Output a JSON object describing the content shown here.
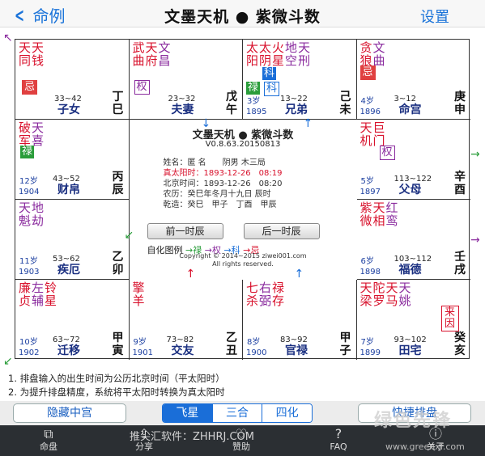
{
  "nav": {
    "back": "命例",
    "title": "文墨天机 ● 紫微斗数",
    "settings": "设置"
  },
  "colors": {
    "accent": "#1a73d9",
    "red": "#d8102b",
    "green": "#2a9d3a",
    "purple": "#8a2b9e"
  },
  "cells": [
    {
      "cols": [
        [
          "天",
          "同"
        ],
        [
          "天",
          "钱"
        ]
      ],
      "colors": [
        "#d8102b",
        "#d8102b"
      ],
      "hua": [
        {
          "t": "忌",
          "cls": "h-ji",
          "l": 8,
          "t2": 50
        }
      ],
      "age": "",
      "year": "",
      "range": "33~42",
      "palace": "子女",
      "gz": [
        "丁",
        "巳"
      ]
    },
    {
      "cols": [
        [
          "武",
          "曲"
        ],
        [
          "天",
          "府"
        ],
        [
          "文",
          "昌"
        ]
      ],
      "colors": [
        "#d8102b",
        "#d8102b",
        "#8a2b9e"
      ],
      "hua": [
        {
          "t": "权",
          "cls": "h-quan",
          "l": 6,
          "t2": 50
        }
      ],
      "age": "",
      "year": "",
      "range": "23~32",
      "palace": "夫妻",
      "gz": [
        "戊",
        "午"
      ]
    },
    {
      "cols": [
        [
          "太",
          "阳"
        ],
        [
          "太",
          "阴"
        ],
        [
          "火",
          "星"
        ],
        [
          "地",
          "空"
        ],
        [
          "天",
          "刑"
        ]
      ],
      "colors": [
        "#d8102b",
        "#d8102b",
        "#d8102b",
        "#8a2b9e",
        "#8a2b9e"
      ],
      "hua": [
        {
          "t": "科",
          "cls": "h-kered",
          "l": 24,
          "t2": 34
        },
        {
          "t": "禄",
          "cls": "h-lu",
          "l": 4,
          "t2": 52
        },
        {
          "t": "科",
          "cls": "h-ke",
          "l": 26,
          "t2": 52
        }
      ],
      "age": "3岁",
      "year": "1895",
      "range": "13~22",
      "palace": "兄弟",
      "gz": [
        "己",
        "未"
      ]
    },
    {
      "cols": [
        [
          "贪",
          "狼"
        ],
        [
          "文",
          "曲"
        ]
      ],
      "colors": [
        "#d8102b",
        "#8a2b9e"
      ],
      "hua": [
        {
          "t": "忌",
          "cls": "h-ji",
          "l": 4,
          "t2": 32
        }
      ],
      "age": "4岁",
      "year": "1896",
      "range": "3~12",
      "palace": "命宫",
      "gz": [
        "庚",
        "申"
      ]
    },
    {
      "cols": [
        [
          "破",
          "军"
        ],
        [
          "天",
          "喜"
        ]
      ],
      "colors": [
        "#d8102b",
        "#8a2b9e"
      ],
      "hua": [
        {
          "t": "禄",
          "cls": "h-lu",
          "l": 6,
          "t2": 32
        }
      ],
      "age": "12岁",
      "year": "1904",
      "range": "43~52",
      "palace": "财帛",
      "gz": [
        "丙",
        "辰"
      ]
    },
    {
      "cols": [
        [
          "天",
          "机"
        ],
        [
          "巨",
          "门"
        ]
      ],
      "colors": [
        "#d8102b",
        "#d8102b"
      ],
      "hua": [
        {
          "t": "权",
          "cls": "h-quan",
          "l": 28,
          "t2": 32
        }
      ],
      "age": "5岁",
      "year": "1897",
      "range": "113~122",
      "palace": "父母",
      "gz": [
        "辛",
        "酉"
      ]
    },
    {
      "cols": [
        [
          "天",
          "魁"
        ],
        [
          "地",
          "劫"
        ]
      ],
      "colors": [
        "#8a2b9e",
        "#8a2b9e"
      ],
      "hua": [],
      "age": "11岁",
      "year": "1903",
      "range": "53~62",
      "palace": "疾厄",
      "gz": [
        "乙",
        "卯"
      ]
    },
    {
      "cols": [
        [
          "紫",
          "微"
        ],
        [
          "天",
          "相"
        ],
        [
          "红",
          "鸾"
        ]
      ],
      "colors": [
        "#d8102b",
        "#d8102b",
        "#8a2b9e"
      ],
      "hua": [],
      "age": "6岁",
      "year": "1898",
      "range": "103~112",
      "palace": "福德",
      "gz": [
        "壬",
        "戌"
      ]
    },
    {
      "cols": [
        [
          "廉",
          "贞"
        ],
        [
          "左",
          "辅"
        ],
        [
          "铃",
          "星"
        ]
      ],
      "colors": [
        "#d8102b",
        "#8a2b9e",
        "#d8102b"
      ],
      "hua": [],
      "age": "10岁",
      "year": "1902",
      "range": "63~72",
      "palace": "迁移",
      "gz": [
        "甲",
        "寅"
      ]
    },
    {
      "cols": [
        [
          "擎",
          "羊"
        ]
      ],
      "colors": [
        "#d8102b"
      ],
      "hua": [],
      "age": "9岁",
      "year": "1901",
      "range": "73~82",
      "palace": "交友",
      "gz": [
        "乙",
        "丑"
      ]
    },
    {
      "cols": [
        [
          "七",
          "杀"
        ],
        [
          "右",
          "弼"
        ],
        [
          "禄",
          "存"
        ]
      ],
      "colors": [
        "#d8102b",
        "#8a2b9e",
        "#d8102b"
      ],
      "hua": [],
      "age": "8岁",
      "year": "1900",
      "range": "83~92",
      "palace": "官禄",
      "gz": [
        "甲",
        "子"
      ]
    },
    {
      "cols": [
        [
          "天",
          "梁"
        ],
        [
          "陀",
          "罗"
        ],
        [
          "天",
          "马"
        ],
        [
          "天",
          "姚"
        ]
      ],
      "colors": [
        "#d8102b",
        "#d8102b",
        "#d8102b",
        "#8a2b9e"
      ],
      "hua": [
        {
          "t": "来因",
          "cls": "h-quanred",
          "l": 104,
          "t2": 32
        }
      ],
      "age": "7岁",
      "year": "1899",
      "range": "93~102",
      "palace": "田宅",
      "gz": [
        "癸",
        "亥"
      ]
    }
  ],
  "center": {
    "title": "文墨天机 ● 紫微斗数",
    "version": "V0.8.63.20150813",
    "name": "姓名：匿 名　　阴男 木三局",
    "true_time": "真太阳时：1893-12-26　08:19",
    "beijing": "北京时间：1893-12-26　08:20",
    "lunar": "农历：癸巳年冬月十九日 辰时",
    "bazi": "乾造：癸巳　甲子　丁酉　甲辰",
    "prev_btn": "前一时辰",
    "next_btn": "后一时辰",
    "legend_label": "自化图例",
    "legend_lu": "禄",
    "legend_quan": "权",
    "legend_ke": "科",
    "legend_ji": "忌",
    "copyright1": "Copyright © 2014~2015 ziwei001.com",
    "copyright2": "All rights reserved."
  },
  "notes": [
    "1. 排盘输入的出生时间为公历北京时间（平太阳时）",
    "2. 为提升排盘精度，系统将平太阳时转换为真太阳时"
  ],
  "toolbar": {
    "hide_center": "隐藏中宫",
    "seg": [
      "飞星",
      "三合",
      "四化"
    ],
    "quick": "快捷排盘"
  },
  "tabs": [
    {
      "icon": "chart-icon",
      "label": "命盘"
    },
    {
      "icon": "share-icon",
      "label": "分享"
    },
    {
      "icon": "donate-icon",
      "label": "赞助"
    },
    {
      "icon": "faq-icon",
      "label": "FAQ"
    },
    {
      "icon": "about-icon",
      "label": "关于"
    }
  ],
  "watermark": "推尖汇软件：ZHHRJ.COM",
  "watermark2": "绿色先锋",
  "watermark3": "www.greenxf.com"
}
